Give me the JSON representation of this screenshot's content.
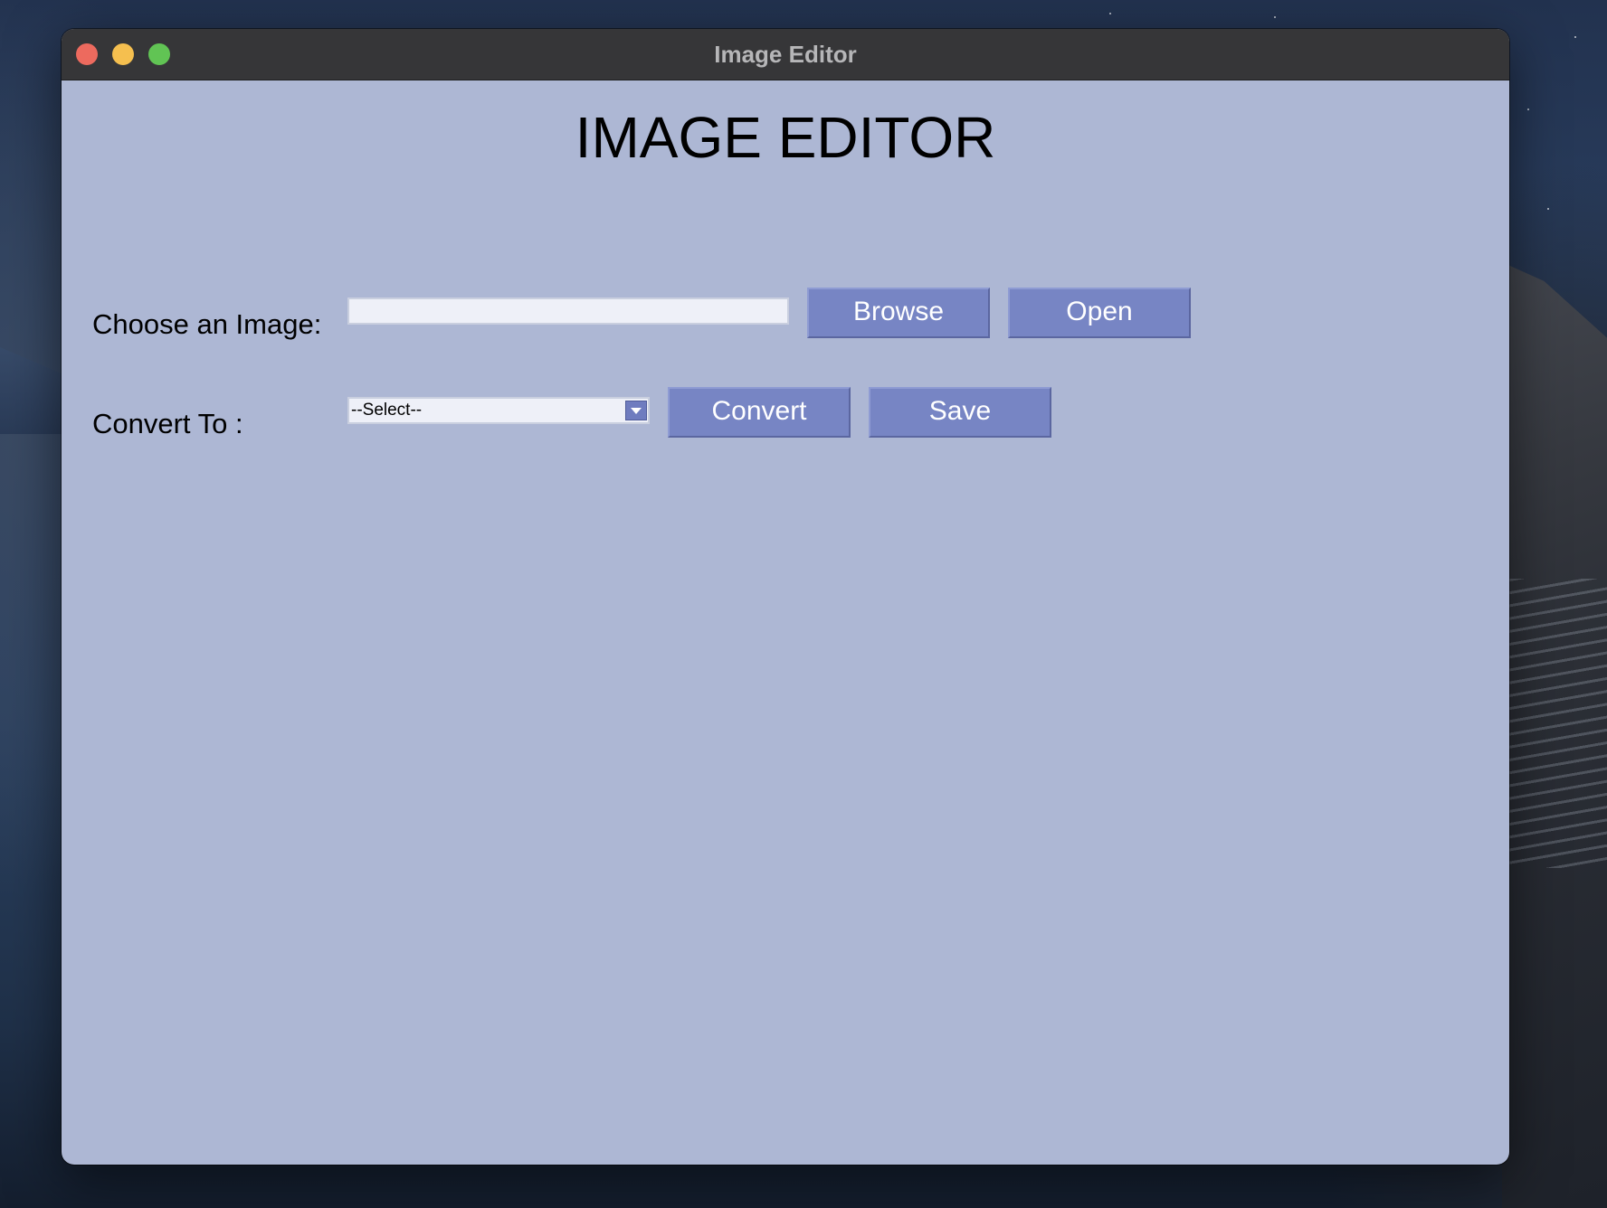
{
  "window": {
    "title": "Image Editor"
  },
  "app": {
    "heading": "IMAGE EDITOR",
    "choose_label": "Choose an Image:",
    "image_path_value": "",
    "image_path_placeholder": "",
    "browse_label": "Browse",
    "open_label": "Open",
    "convert_to_label": "Convert To :",
    "format_select": {
      "selected": "--Select--"
    },
    "convert_label": "Convert",
    "save_label": "Save"
  },
  "colors": {
    "window_background": "#adb7d4",
    "button_background": "#7785c4",
    "titlebar_background": "#363638"
  },
  "icons": {
    "select_arrow": "chevron-down-icon"
  }
}
